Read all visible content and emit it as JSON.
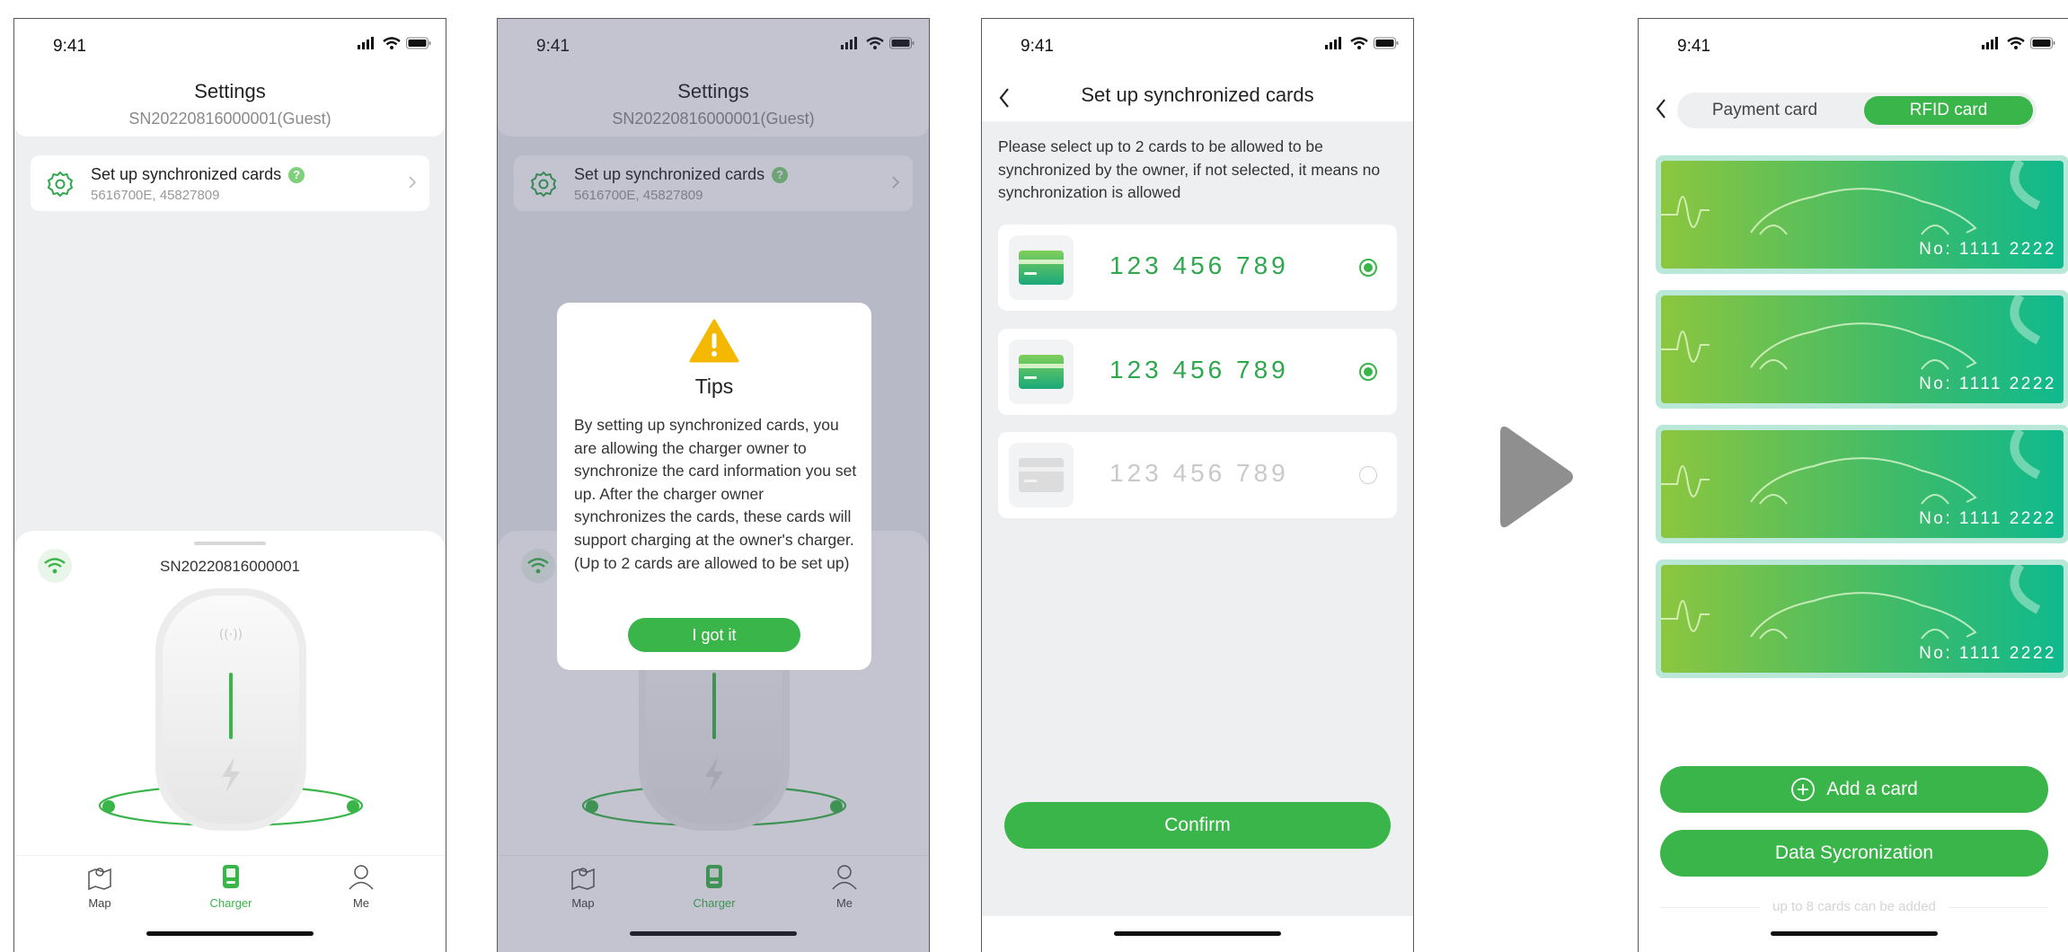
{
  "status": {
    "time": "9:41"
  },
  "settings": {
    "title": "Settings",
    "device_label": "SN20220816000001(Guest)",
    "sync_title": "Set up synchronized cards",
    "sync_help": "?",
    "sync_cards": "5616700E, 45827809"
  },
  "charger": {
    "serial": "SN20220816000001"
  },
  "tabs": {
    "map": "Map",
    "charger": "Charger",
    "me": "Me"
  },
  "tips": {
    "title": "Tips",
    "body": "By setting up synchronized cards, you are allowing the charger owner to synchronize the card information you set up. After the charger owner synchronizes the cards, these cards will support charging at the owner's charger. (Up to 2 cards are allowed to be set up)",
    "button": "I got it"
  },
  "sync_screen": {
    "title": "Set up synchronized cards",
    "description": "Please select up to 2 cards to be allowed to be synchronized by the owner, if not selected, it means no synchronization is allowed",
    "cards": [
      {
        "number": "123 456 789",
        "selected": true
      },
      {
        "number": "123 456 789",
        "selected": true
      },
      {
        "number": "123 456 789",
        "selected": false
      }
    ],
    "confirm": "Confirm"
  },
  "cards_screen": {
    "tab_payment": "Payment card",
    "tab_rfid": "RFID card",
    "cards": [
      {
        "number": "No: 1111 2222"
      },
      {
        "number": "No: 1111 2222"
      },
      {
        "number": "No: 1111 2222"
      },
      {
        "number": "No: 1111 2222"
      }
    ],
    "add_card": "Add a card",
    "sync_button": "Data Sycronization",
    "hint": "up to 8 cards can be added"
  },
  "colors": {
    "accent": "#3ab549",
    "card_gradient_start": "#8cc63f",
    "card_gradient_end": "#0fb98e"
  },
  "icons": [
    "signal-icon",
    "wifi-icon",
    "battery-icon",
    "gear-icon",
    "help-icon",
    "chevron-right-icon",
    "wifi-badge-icon",
    "map-icon",
    "charger-icon",
    "person-icon",
    "warning-icon",
    "back-icon",
    "card-icon",
    "play-arrow-icon",
    "plus-circle-icon"
  ]
}
